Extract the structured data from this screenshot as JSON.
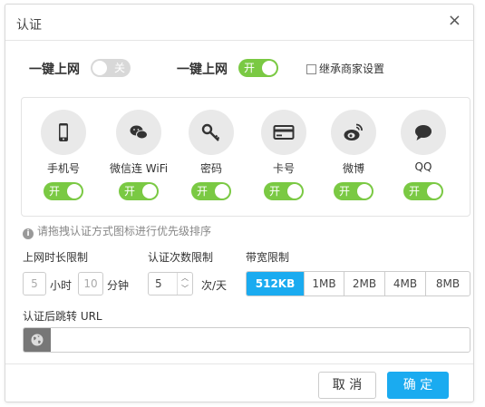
{
  "dialog": {
    "title": "认证",
    "close": "×"
  },
  "top_row": {
    "label1": "一键上网",
    "toggle1": {
      "state": "off",
      "text": "关"
    },
    "label2": "一键上网",
    "toggle2": {
      "state": "on",
      "text": "开"
    },
    "inherit_label": "继承商家设置"
  },
  "methods": [
    {
      "icon": "phone-icon",
      "label": "手机号",
      "toggle": {
        "state": "on",
        "text": "开"
      }
    },
    {
      "icon": "wechat-icon",
      "label": "微信连 WiFi",
      "toggle": {
        "state": "on",
        "text": "开"
      }
    },
    {
      "icon": "key-icon",
      "label": "密码",
      "toggle": {
        "state": "on",
        "text": "开"
      }
    },
    {
      "icon": "card-icon",
      "label": "卡号",
      "toggle": {
        "state": "on",
        "text": "开"
      }
    },
    {
      "icon": "weibo-icon",
      "label": "微博",
      "toggle": {
        "state": "on",
        "text": "开"
      }
    },
    {
      "icon": "qq-icon",
      "label": "QQ",
      "toggle": {
        "state": "on",
        "text": "开"
      }
    }
  ],
  "hint": "请拖拽认证方式图标进行优先级排序",
  "limits": {
    "duration_label": "上网时长限制",
    "hours_value": "5",
    "hours_unit": "小时",
    "minutes_value": "10",
    "minutes_unit": "分钟",
    "count_label": "认证次数限制",
    "count_value": "5",
    "count_unit": "次/天",
    "bandwidth_label": "带宽限制",
    "bandwidth_options": [
      "512KB",
      "1MB",
      "2MB",
      "4MB",
      "8MB"
    ],
    "bandwidth_selected": "512KB"
  },
  "redirect": {
    "label": "认证后跳转 URL",
    "value": ""
  },
  "footer": {
    "cancel": "取 消",
    "ok": "确 定"
  },
  "colors": {
    "toggle_on": "#7ac943",
    "toggle_off": "#d8d8d8",
    "primary": "#1aabf0"
  }
}
